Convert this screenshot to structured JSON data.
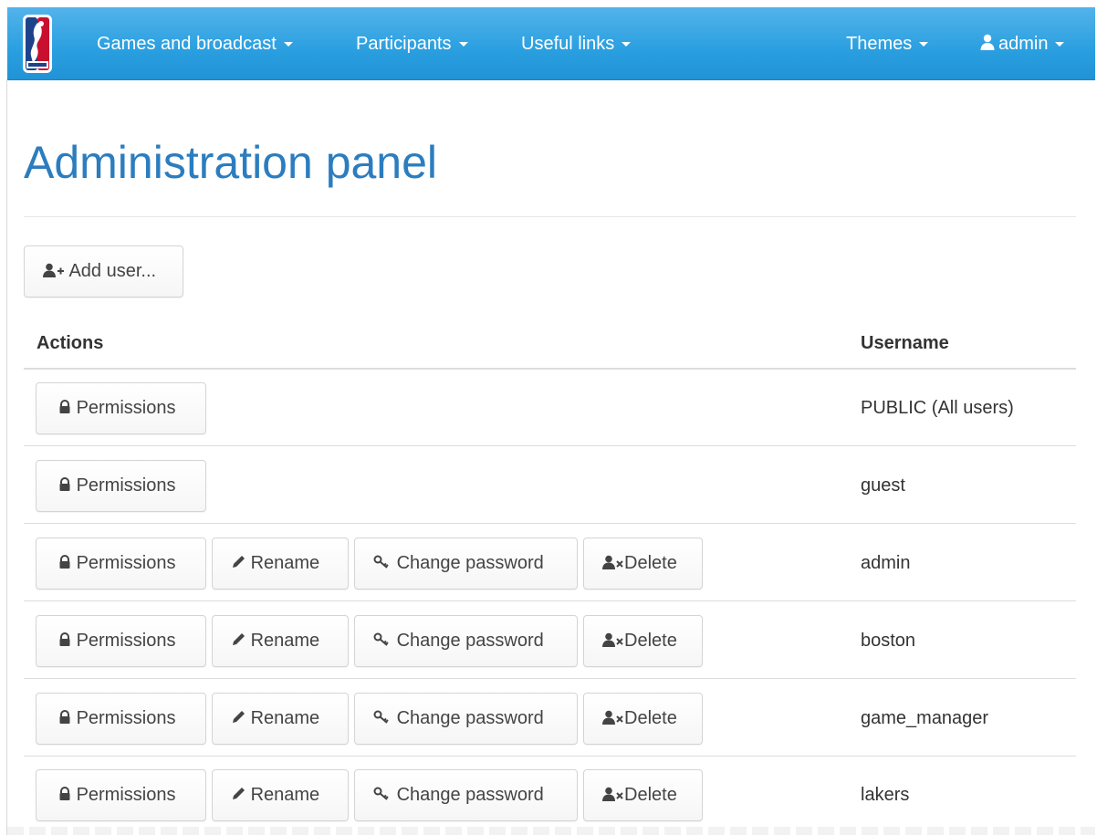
{
  "navbar": {
    "logo_icon": "nba-logo-icon",
    "menus": [
      {
        "label": "Games and broadcast"
      },
      {
        "label": "Participants"
      },
      {
        "label": "Useful links"
      }
    ],
    "themes_label": "Themes",
    "user_icon": "user-icon",
    "user_label": "admin",
    "colors": {
      "background": "#2a9fe0",
      "text": "#ffffff"
    }
  },
  "page": {
    "title": "Administration panel",
    "title_color": "#2b7dbf"
  },
  "toolbar": {
    "add_user_label": "Add user...",
    "add_user_icon": "user-plus-icon"
  },
  "table": {
    "headers": {
      "actions": "Actions",
      "username": "Username"
    },
    "buttons": {
      "permissions": "Permissions",
      "rename": "Rename",
      "change_password": "Change password",
      "delete": "Delete"
    },
    "icons": {
      "permissions": "lock-icon",
      "rename": "pencil-icon",
      "change_password": "key-icon",
      "delete": "user-remove-icon"
    },
    "rows": [
      {
        "username": "PUBLIC (All users)",
        "full_actions": false
      },
      {
        "username": "guest",
        "full_actions": false
      },
      {
        "username": "admin",
        "full_actions": true
      },
      {
        "username": "boston",
        "full_actions": true
      },
      {
        "username": "game_manager",
        "full_actions": true
      },
      {
        "username": "lakers",
        "full_actions": true
      }
    ]
  }
}
